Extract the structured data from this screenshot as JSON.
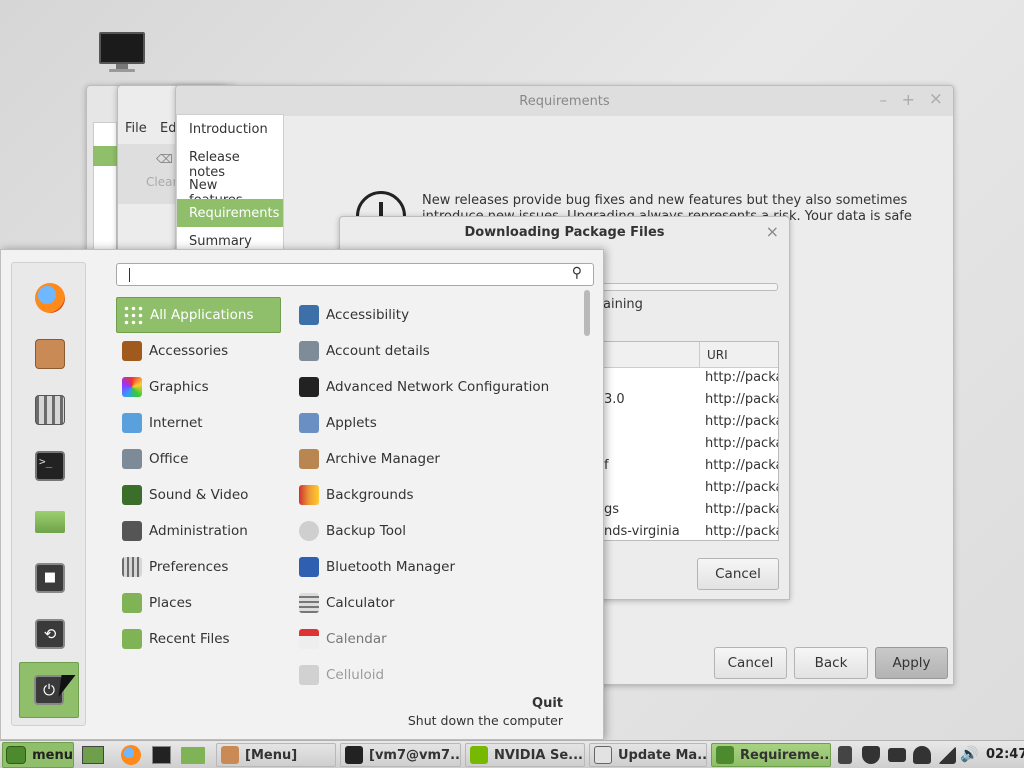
{
  "desktop": {
    "icon": "computer-icon"
  },
  "bg_window_1": {
    "menu_file": "File",
    "menu_edit": "Edi",
    "clear_label": "Clear"
  },
  "requirements_window": {
    "title": "Requirements",
    "controls": {
      "minimize": "–",
      "maximize": "+",
      "close": "×"
    },
    "steps": [
      "Introduction",
      "Release notes",
      "New features",
      "Requirements",
      "Summary"
    ],
    "selected_step": "Requirements",
    "notice_line1": "New releases provide bug fixes and new features but they also sometimes",
    "notice_line2": "introduce new issues. Upgrading always represents a risk. Your data is safe",
    "buttons": {
      "cancel": "Cancel",
      "back": "Back",
      "apply": "Apply"
    }
  },
  "download_dialog": {
    "title": "Downloading Package Files",
    "close": "×",
    "remaining_fragment": "aining",
    "progress": 0,
    "columns": [
      "",
      "URI"
    ],
    "rows": [
      {
        "name": "",
        "uri": "http://packa"
      },
      {
        "name": "3.0",
        "uri": "http://packa"
      },
      {
        "name": "",
        "uri": "http://packa"
      },
      {
        "name": "",
        "uri": "http://packa"
      },
      {
        "name": "f",
        "uri": "http://packa"
      },
      {
        "name": "",
        "uri": "http://packa"
      },
      {
        "name": "gs",
        "uri": "http://packa"
      },
      {
        "name": "nds-virginia",
        "uri": "http://packa"
      }
    ],
    "cancel": "Cancel"
  },
  "menu": {
    "search": {
      "value": "",
      "placeholder": ""
    },
    "favorites": [
      "firefox-icon",
      "software-manager-icon",
      "settings-icon",
      "terminal-icon",
      "folder-icon",
      "lock-screen-icon",
      "logout-icon",
      "power-icon"
    ],
    "categories": [
      "All Applications",
      "Accessories",
      "Graphics",
      "Internet",
      "Office",
      "Sound & Video",
      "Administration",
      "Preferences",
      "Places",
      "Recent Files"
    ],
    "selected_category": "All Applications",
    "apps": [
      "Accessibility",
      "Account details",
      "Advanced Network Configuration",
      "Applets",
      "Archive Manager",
      "Backgrounds",
      "Backup Tool",
      "Bluetooth Manager",
      "Calculator",
      "Calendar",
      "Celluloid"
    ],
    "footer": {
      "title": "Quit",
      "subtitle": "Shut down the computer"
    }
  },
  "taskbar": {
    "menu_label": "menu",
    "windows": [
      "[Menu]",
      "[vm7@vm7...",
      "NVIDIA Se...",
      "Update Ma...",
      "Requireme..."
    ],
    "clock": "02:47"
  },
  "colors": {
    "accent": "#8fbf6a",
    "accent_dark": "#6f9e4d",
    "panel": "#f2f2f2",
    "taskbar": "#d8d8d8"
  }
}
